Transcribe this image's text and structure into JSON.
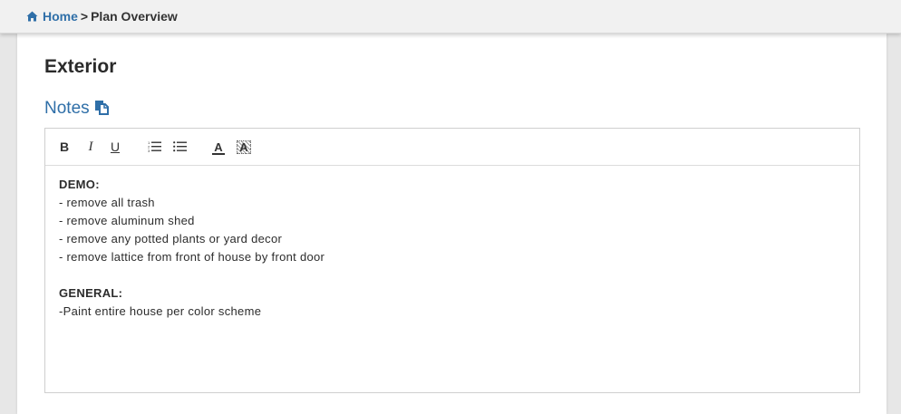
{
  "breadcrumb": {
    "home_label": "Home",
    "separator": ">",
    "current_label": "Plan Overview"
  },
  "page": {
    "title": "Exterior"
  },
  "notes": {
    "heading": "Notes",
    "toolbar": {
      "bold": "B",
      "italic": "I",
      "underline": "U",
      "font_color": "A",
      "highlight": "A"
    },
    "content": {
      "section1_heading": "DEMO:",
      "section1_items": [
        "- remove all trash",
        "- remove aluminum shed",
        "- remove any potted plants or yard decor",
        "- remove lattice from front of house by front door"
      ],
      "section2_heading": "GENERAL:",
      "section2_items": [
        "-Paint entire house per color scheme"
      ]
    }
  },
  "colors": {
    "link_blue": "#2f6fa8",
    "text_dark": "#333333",
    "background": "#e7e7e7"
  },
  "icons": {
    "home": "home-icon",
    "copy": "copy-icon",
    "ordered_list": "ordered-list-icon",
    "unordered_list": "unordered-list-icon"
  }
}
